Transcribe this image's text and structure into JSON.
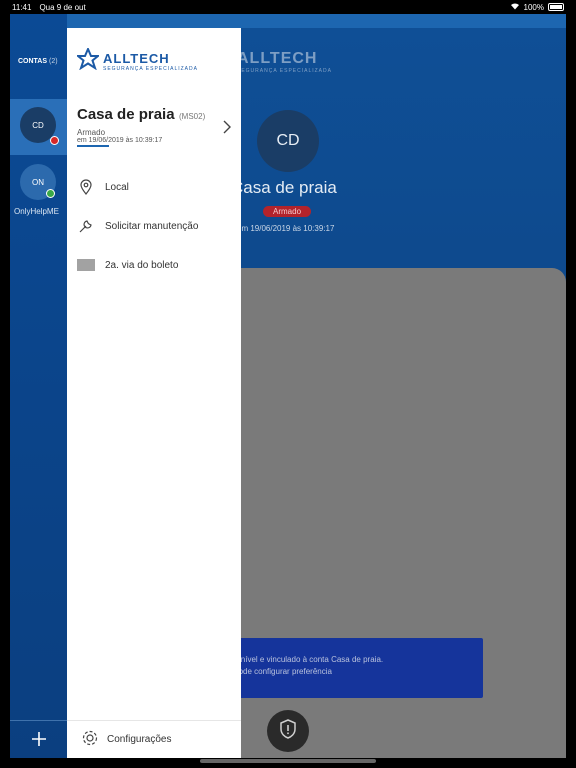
{
  "status_bar": {
    "time": "11:41",
    "date": "Qua 9 de out",
    "battery": "100%"
  },
  "brand": {
    "name": "ALLTECH",
    "subtitle": "SEGURANÇA ESPECIALIZADA"
  },
  "rail": {
    "title": "CONTAS",
    "count": "(2)",
    "accounts": [
      {
        "initials": "CD",
        "status_color": "#d62828"
      },
      {
        "initials": "ON",
        "name": "OnlyHelpME",
        "status_color": "#3aa847"
      }
    ],
    "add_icon": "plus-icon"
  },
  "drawer": {
    "account": {
      "name": "Casa de praia",
      "code": "(MS02)",
      "status": "Armado",
      "date": "em 19/06/2019 às 10:39:17"
    },
    "menu": [
      {
        "label": "Local",
        "icon": "location-pin-icon"
      },
      {
        "label": "Solicitar manutenção",
        "icon": "wrench-icon"
      },
      {
        "label": "2a. via do boleto",
        "icon": "barcode-icon"
      }
    ],
    "footer": {
      "label": "Configurações",
      "icon": "gear-icon"
    }
  },
  "main": {
    "avatar": "CD",
    "title": "Casa de praia",
    "status": "Armado",
    "date": "em 19/06/2019 às 10:39:17",
    "toast": {
      "line1": "à disponível e vinculado à conta Casa de praia.",
      "line2": "você pode configurar preferência"
    }
  },
  "colors": {
    "primary": "#1d66b0",
    "armed": "#b3232b",
    "online": "#3aa847"
  }
}
